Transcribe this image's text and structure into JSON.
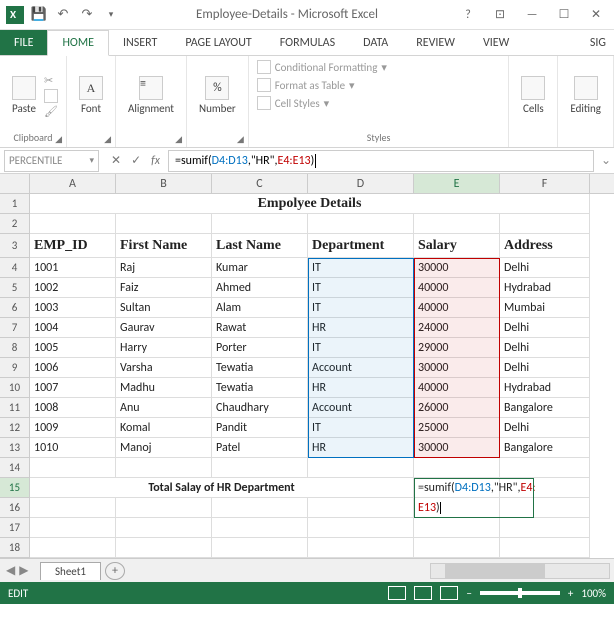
{
  "titlebar": {
    "title": "Employee-Details - Microsoft Excel"
  },
  "ribbon": {
    "tabs": {
      "file": "FILE",
      "home": "HOME",
      "insert": "INSERT",
      "pagelayout": "PAGE LAYOUT",
      "formulas": "FORMULAS",
      "data": "DATA",
      "review": "REVIEW",
      "view": "VIEW",
      "signin": "Sig"
    },
    "groups": {
      "clipboard": {
        "label": "Clipboard",
        "paste": "Paste"
      },
      "font": {
        "label": "Font"
      },
      "alignment": {
        "label": "Alignment"
      },
      "number": {
        "label": "Number"
      },
      "styles": {
        "label": "Styles",
        "cond": "Conditional Formatting",
        "table": "Format as Table",
        "cell": "Cell Styles"
      },
      "cells": {
        "label": "Cells"
      },
      "editing": {
        "label": "Editing"
      }
    }
  },
  "namebox": "PERCENTILE",
  "formula": {
    "pre": "=sumif(",
    "r1": "D4:D13",
    "mid": ",\"HR\",",
    "r2": "E4:E13",
    "post": ")"
  },
  "cols": [
    "A",
    "B",
    "C",
    "D",
    "E",
    "F"
  ],
  "title_cell": "Empolyee Details",
  "headers": {
    "emp": "EMP_ID",
    "first": "First Name",
    "last": "Last Name",
    "dept": "Department",
    "salary": "Salary",
    "addr": "Address"
  },
  "rows": [
    {
      "n": 4,
      "id": "1001",
      "first": "Raj",
      "last": "Kumar",
      "dept": "IT",
      "salary": "30000",
      "addr": "Delhi"
    },
    {
      "n": 5,
      "id": "1002",
      "first": "Faiz",
      "last": "Ahmed",
      "dept": "IT",
      "salary": "40000",
      "addr": "Hydrabad"
    },
    {
      "n": 6,
      "id": "1003",
      "first": "Sultan",
      "last": "Alam",
      "dept": "IT",
      "salary": "40000",
      "addr": "Mumbai"
    },
    {
      "n": 7,
      "id": "1004",
      "first": "Gaurav",
      "last": "Rawat",
      "dept": "HR",
      "salary": "24000",
      "addr": "Delhi"
    },
    {
      "n": 8,
      "id": "1005",
      "first": "Harry",
      "last": "Porter",
      "dept": "IT",
      "salary": "29000",
      "addr": "Delhi"
    },
    {
      "n": 9,
      "id": "1006",
      "first": "Varsha",
      "last": "Tewatia",
      "dept": "Account",
      "salary": "30000",
      "addr": "Delhi"
    },
    {
      "n": 10,
      "id": "1007",
      "first": "Madhu",
      "last": "Tewatia",
      "dept": "HR",
      "salary": "40000",
      "addr": "Hydrabad"
    },
    {
      "n": 11,
      "id": "1008",
      "first": "Anu",
      "last": "Chaudhary",
      "dept": "Account",
      "salary": "26000",
      "addr": "Bangalore"
    },
    {
      "n": 12,
      "id": "1009",
      "first": "Komal",
      "last": "Pandit",
      "dept": "IT",
      "salary": "25000",
      "addr": "Delhi"
    },
    {
      "n": 13,
      "id": "1010",
      "first": "Manoj",
      "last": "Patel",
      "dept": "HR",
      "salary": "30000",
      "addr": "Bangalore"
    }
  ],
  "summary_label": "Total Salay of HR Department",
  "e15": {
    "pre": "=sumif(",
    "r1": "D4:D13",
    "mid": ",\"HR\",",
    "r2a": "E4:",
    "r2b": "E13",
    "post": ")"
  },
  "sheettab": "Sheet1",
  "status": {
    "mode": "EDIT",
    "zoom": "100%"
  },
  "active_col": "E",
  "active_row": 15
}
